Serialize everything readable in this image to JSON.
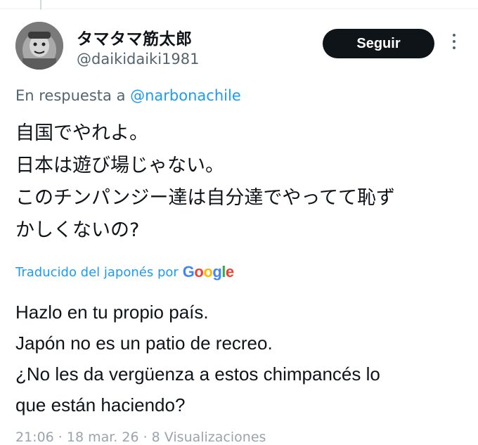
{
  "tweet": {
    "display_name": "タマタマ筋太郎",
    "handle": "@daikidaiki1981",
    "follow_label": "Seguir",
    "reply_prefix": "En respuesta a",
    "reply_mention": "@narbonachile",
    "original_lines": [
      "自国でやれよ。",
      "日本は遊び場じゃない。",
      "このチンパンジー達は自分達でやってて恥ず",
      "かしくないの?"
    ],
    "translated_by": "Traducido del japonés por",
    "translator_brand": "Google",
    "translation_lines": [
      "Hazlo en tu propio país.",
      "Japón no es un patio de recreo.",
      "¿No les da vergüenza a estos chimpancés lo",
      "que están haciendo?"
    ],
    "meta": "21:06 · 18 mar. 26 · 8 Visualizaciones"
  },
  "icons": {
    "more": "more-vertical-icon",
    "avatar": "avatar-image"
  },
  "colors": {
    "accent": "#1d9bf0",
    "secondary_text": "#536471",
    "button_bg": "#0f1419"
  }
}
